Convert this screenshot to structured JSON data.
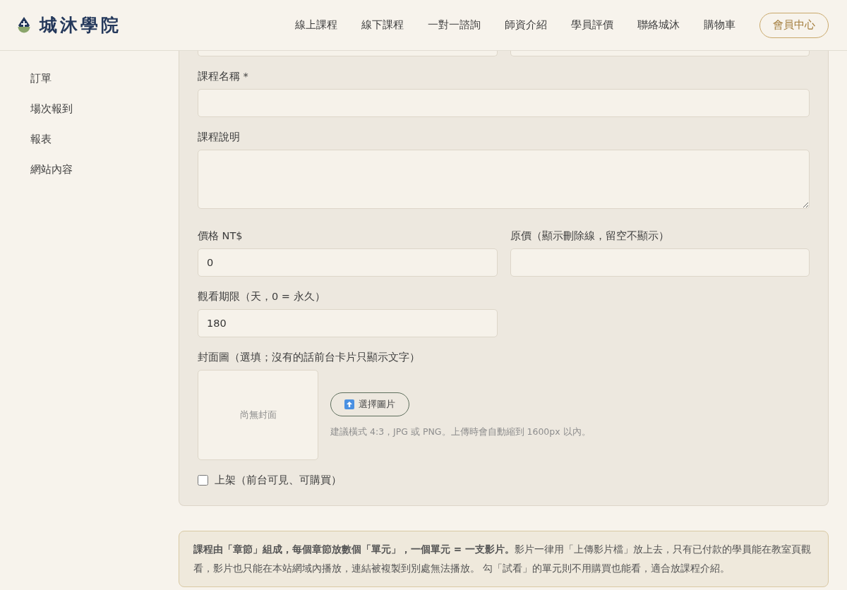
{
  "header": {
    "logo": "城沐學院",
    "nav": [
      {
        "label": "線上課程"
      },
      {
        "label": "線下課程"
      },
      {
        "label": "一對一諮詢"
      },
      {
        "label": "師資介紹"
      },
      {
        "label": "學員評價"
      },
      {
        "label": "聯絡城沐"
      },
      {
        "label": "購物車"
      }
    ],
    "member_button": "會員中心"
  },
  "sidebar": {
    "items": [
      {
        "label": "訂單"
      },
      {
        "label": "場次報到"
      },
      {
        "label": "報表"
      },
      {
        "label": "網站內容"
      }
    ]
  },
  "form": {
    "title_field": {
      "label": "課程名稱 *"
    },
    "description_field": {
      "label": "課程說明"
    },
    "price_field": {
      "label": "價格 NT$",
      "value": "0"
    },
    "original_price_field": {
      "label": "原價（顯示刪除線，留空不顯示）"
    },
    "period_field": {
      "label": "觀看期限（天，0 = 永久）",
      "value": "180"
    },
    "cover": {
      "label": "封面圖（選填；沒有的話前台卡片只顯示文字）",
      "empty_text": "尚無封面",
      "button": "選擇圖片",
      "hint": "建議橫式 4:3，JPG 或 PNG。上傳時會自動縮到 1600px 以內。"
    },
    "published": {
      "label": "上架（前台可見、可購買）",
      "checked": false
    }
  },
  "note": "**課程由「章節」組成，每個章節放數個「單元」，一個單元 = 一支影片。**影片一律用「上傳影片檔」放上去，只有已付款的學員能在教室頁觀看，影片也只能在本站網域內播放，連結被複製到別處無法播放。 勾「試看」的單元則不用購買也能看，適合放課程介紹。"
}
